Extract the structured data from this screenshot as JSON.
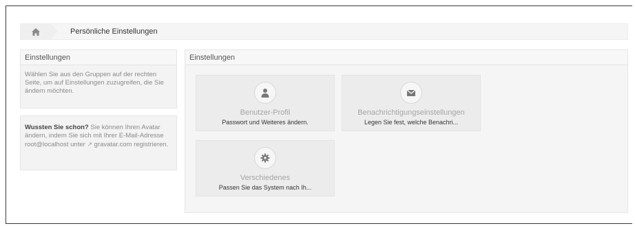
{
  "breadcrumb": {
    "home_icon": "home-icon",
    "current": "Persönliche Einstellungen"
  },
  "sidebar": {
    "groups_box": {
      "title": "Einstellungen",
      "text": "Wählen Sie aus den Gruppen auf der rechten Seite, um auf Einstellungen zuzugreifen, die Sie ändern möchten."
    },
    "tip_box": {
      "bold": "Wussten Sie schon?",
      "text_before_link": " Sie können Ihren Avatar ändern, indem Sie sich mit Ihrer E-Mail-Adresse root@localhost unter ",
      "link": "gravatar.com",
      "text_after_link": " registrieren."
    }
  },
  "main": {
    "title": "Einstellungen",
    "tiles": [
      {
        "icon": "user-icon",
        "title": "Benutzer-Profil",
        "desc": "Passwort und Weiteres ändern."
      },
      {
        "icon": "envelope-icon",
        "title": "Benachrichtigungseinstellungen",
        "desc": "Legen Sie fest, welche Benachri..."
      },
      {
        "icon": "gear-icon",
        "title": "Verschiedenes",
        "desc": "Passen Sie das System nach Ih..."
      }
    ]
  },
  "colors": {
    "panel_bg": "#f5f5f5",
    "tile_bg": "#ececec",
    "frame_border": "#3a3a3a"
  }
}
